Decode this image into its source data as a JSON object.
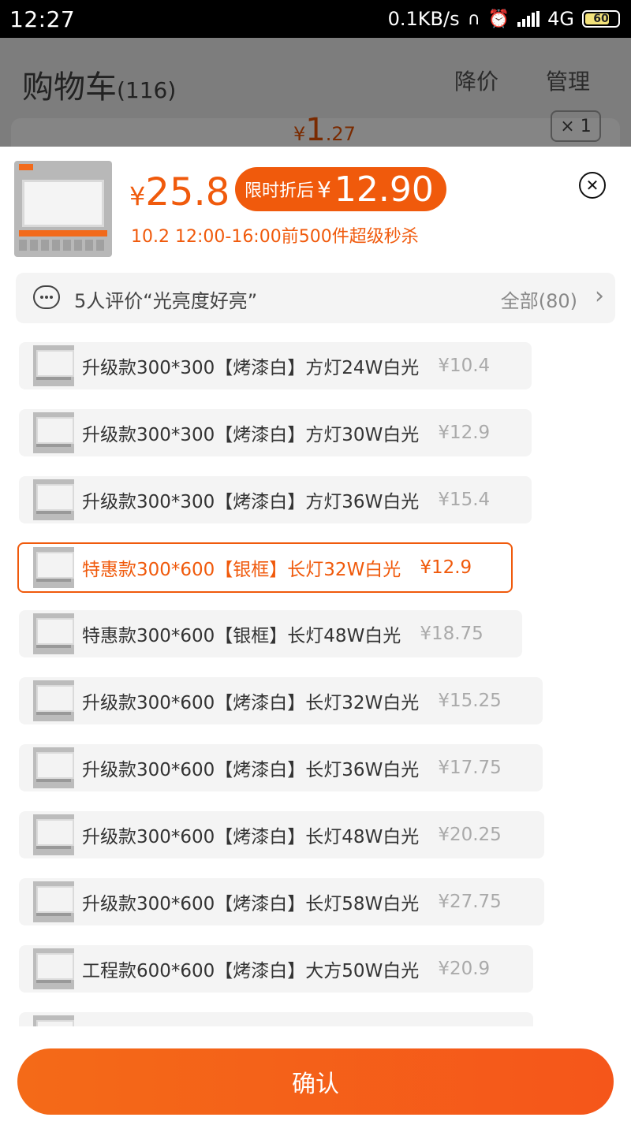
{
  "status_bar": {
    "time": "12:27",
    "network_speed": "0.1KB/s",
    "network_type": "4G",
    "battery": "60"
  },
  "background_page": {
    "title": "购物车",
    "count": "(116)",
    "actions": [
      "降价",
      "管理"
    ],
    "item_price_symbol": "¥",
    "item_price_int": "1",
    "item_price_dec": ".27",
    "stepper_text": "× 1"
  },
  "product": {
    "price_symbol": "¥",
    "price": "25.8",
    "promo_label": "限时折后",
    "promo_symbol": "¥",
    "promo_price": "12.90",
    "flash_sale_text": "10.2 12:00-16:00前500件超级秒杀"
  },
  "reviews": {
    "summary": "5人评价“光亮度好亮”",
    "all_label": "全部(80)"
  },
  "options": [
    {
      "label": "升级款300*300【烤漆白】方灯24W白光",
      "price": "¥10.4",
      "selected": false
    },
    {
      "label": "升级款300*300【烤漆白】方灯30W白光",
      "price": "¥12.9",
      "selected": false
    },
    {
      "label": "升级款300*300【烤漆白】方灯36W白光",
      "price": "¥15.4",
      "selected": false
    },
    {
      "label": "特惠款300*600【银框】长灯32W白光",
      "price": "¥12.9",
      "selected": true
    },
    {
      "label": "特惠款300*600【银框】长灯48W白光",
      "price": "¥18.75",
      "selected": false
    },
    {
      "label": "升级款300*600【烤漆白】长灯32W白光",
      "price": "¥15.25",
      "selected": false
    },
    {
      "label": "升级款300*600【烤漆白】长灯36W白光",
      "price": "¥17.75",
      "selected": false
    },
    {
      "label": "升级款300*600【烤漆白】长灯48W白光",
      "price": "¥20.25",
      "selected": false
    },
    {
      "label": "升级款300*600【烤漆白】长灯58W白光",
      "price": "¥27.75",
      "selected": false
    },
    {
      "label": "工程款600*600【烤漆白】大方50W白光",
      "price": "¥20.9",
      "selected": false
    }
  ],
  "confirm_label": "确认",
  "colors": {
    "accent": "#f05a0c",
    "option_bg": "#f4f4f4",
    "muted_price": "#aaaaaa"
  }
}
